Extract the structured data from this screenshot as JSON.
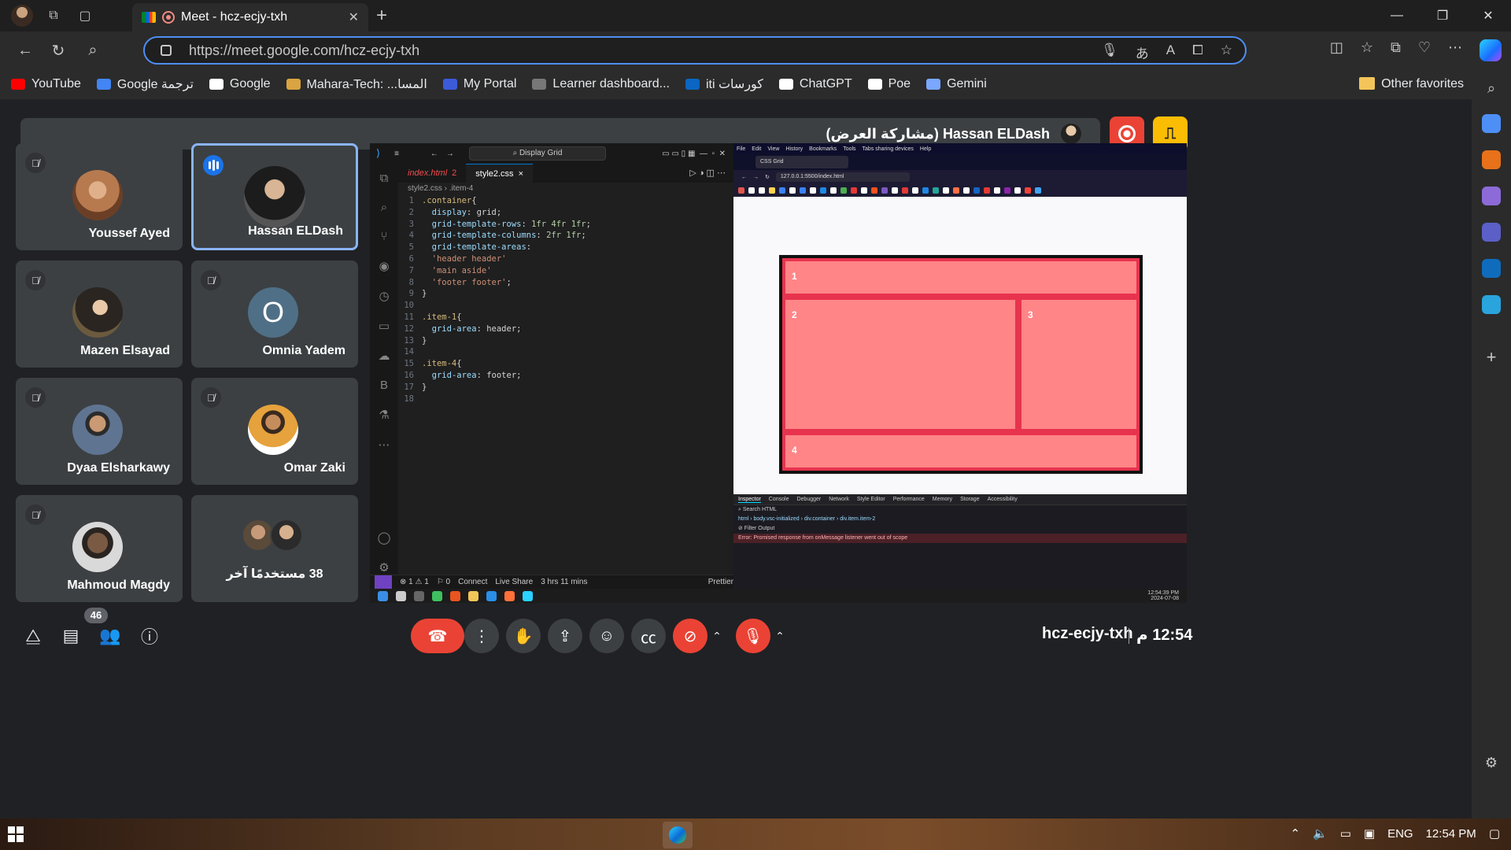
{
  "browser": {
    "tab_title": "Meet - hcz-ecjy-txh",
    "url": "https://meet.google.com/hcz-ecjy-txh",
    "favorites": [
      {
        "label": "YouTube",
        "color": "#ff0000"
      },
      {
        "label": "Google ترجمة",
        "color": "#4285f4"
      },
      {
        "label": "Google",
        "color": "#ffffff"
      },
      {
        "label": "Mahara-Tech: ...المسا",
        "color": "#d9a441"
      },
      {
        "label": "My Portal",
        "color": "#3b5bdb"
      },
      {
        "label": "Learner dashboard...",
        "color": "#777777"
      },
      {
        "label": "iti كورسات",
        "color": "#0a66c2"
      },
      {
        "label": "ChatGPT",
        "color": "#ffffff"
      },
      {
        "label": "Poe",
        "color": "#ffffff"
      },
      {
        "label": "Gemini",
        "color": "#7aa7ff"
      }
    ],
    "other_favorites": "Other favorites"
  },
  "meet": {
    "presenter_bar": "Hassan ELDash (مشاركة العرض)",
    "participants": [
      {
        "name": "Youssef Ayed",
        "state": "muted",
        "avatar_color": "#b77a4f"
      },
      {
        "name": "Hassan ELDash",
        "state": "speaking",
        "avatar_color": "#2d2d2d"
      },
      {
        "name": "Mazen Elsayad",
        "state": "muted",
        "avatar_color": "#3b3327"
      },
      {
        "name": "Omnia Yadem",
        "state": "muted",
        "letter": "O"
      },
      {
        "name": "Dyaa Elsharkawy",
        "state": "muted",
        "avatar_color": "#5f7491"
      },
      {
        "name": "Omar Zaki",
        "state": "muted",
        "avatar_color": "#e6a23c"
      },
      {
        "name": "Mahmoud Magdy",
        "state": "muted",
        "avatar_color": "#5a4a3f"
      }
    ],
    "others_label": "38 مستخدمًا آخر",
    "people_count": "46",
    "meeting_code": "hcz-ecjy-txh",
    "time": "12:54 م"
  },
  "vscode": {
    "search": "Display Grid",
    "tabs": [
      {
        "label": "index.html",
        "badge": "2"
      },
      {
        "label": "style2.css",
        "badge": "×"
      }
    ],
    "breadcrumb": "style2.css › .item-4",
    "lines": [
      ".container{",
      "  display: grid;",
      "  grid-template-rows: 1fr 4fr 1fr;",
      "  grid-template-columns: 2fr 1fr;",
      "  grid-template-areas:",
      "  'header header'",
      "  'main aside'",
      "  'footer footer';",
      "}",
      "",
      ".item-1{",
      "  grid-area: header;",
      "}",
      "",
      ".item-4{",
      "  grid-area: footer;",
      "}",
      ""
    ],
    "status": [
      "⊗ 1 ⚠ 1",
      "⚐ 0",
      "Connect",
      "Live Share",
      "3 hrs 11 mins",
      "Prettier"
    ]
  },
  "firefox": {
    "menu": [
      "File",
      "Edit",
      "View",
      "History",
      "Bookmarks",
      "Tools",
      "Tabs sharing devices",
      "Help"
    ],
    "tab": "CSS Grid",
    "url": "127.0.0.1:5500/index.html",
    "grid_items": [
      "1",
      "2",
      "3",
      "4"
    ],
    "devtools_tabs": [
      "Inspector",
      "Console",
      "Debugger",
      "Network",
      "Style Editor",
      "Performance",
      "Memory",
      "Storage",
      "Accessibility"
    ],
    "devtools_path": "html › body.vsc-initialized › div.container › div.item.item-2",
    "devtools_error": "Error: Promised response from onMessage listener went out of scope",
    "clock": "12:54:39 PM",
    "date": "2024-07-08"
  },
  "taskbar": {
    "lang": "ENG",
    "time": "12:54 PM"
  }
}
